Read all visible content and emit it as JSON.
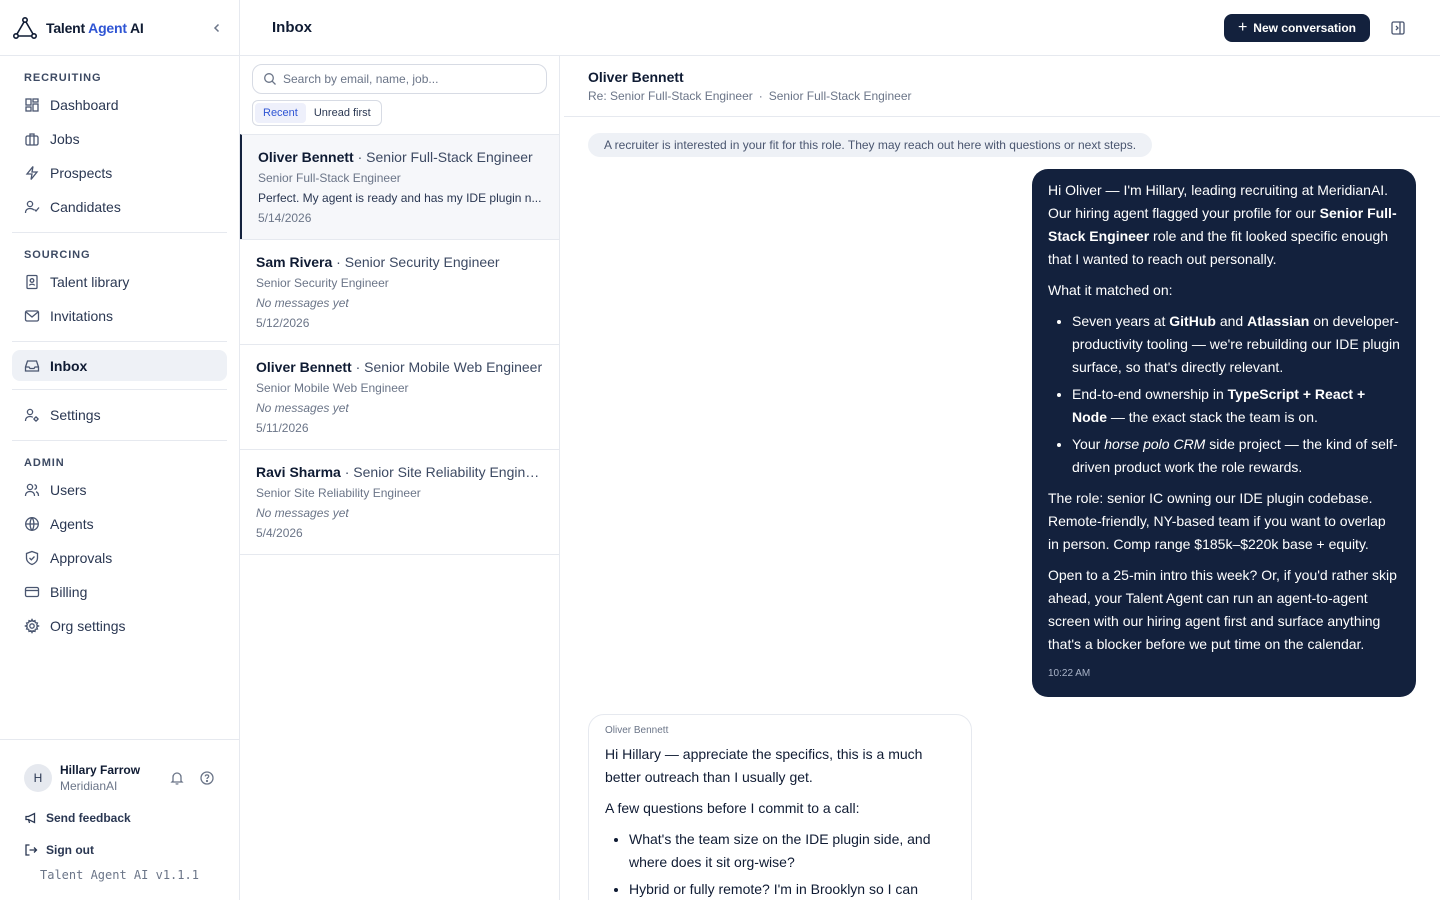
{
  "brand": {
    "name_prefix": "Talent ",
    "name_accent": "Agent",
    "name_suffix": " AI"
  },
  "sidebar": {
    "sections": {
      "recruiting": "RECRUITING",
      "sourcing": "SOURCING",
      "admin": "ADMIN"
    },
    "items": {
      "dashboard": "Dashboard",
      "jobs": "Jobs",
      "prospects": "Prospects",
      "candidates": "Candidates",
      "talent_library": "Talent library",
      "invitations": "Invitations",
      "inbox": "Inbox",
      "settings": "Settings",
      "users": "Users",
      "agents": "Agents",
      "approvals": "Approvals",
      "billing": "Billing",
      "org_settings": "Org settings"
    },
    "user": {
      "initial": "H",
      "name": "Hillary Farrow",
      "org": "MeridianAI"
    },
    "footer": {
      "send_feedback": "Send feedback",
      "sign_out": "Sign out",
      "version": "Talent Agent AI v1.1.1"
    }
  },
  "topbar": {
    "title": "Inbox",
    "new_conversation": "New conversation"
  },
  "convlist": {
    "search_placeholder": "Search by email, name, job...",
    "tabs": [
      "Recent",
      "Unread first"
    ],
    "items": [
      {
        "name": "Oliver Bennett",
        "sep": " · ",
        "title": "Senior Full-Stack Engineer",
        "role": "Senior Full-Stack Engineer",
        "preview": "Perfect. My agent is ready and has my IDE plugin n...",
        "date": "5/14/2026"
      },
      {
        "name": "Sam Rivera",
        "sep": " · ",
        "title": "Senior Security Engineer",
        "role": "Senior Security Engineer",
        "preview": "No messages yet",
        "date": "5/12/2026"
      },
      {
        "name": "Oliver Bennett",
        "sep": " · ",
        "title": "Senior Mobile Web Engineer",
        "role": "Senior Mobile Web Engineer",
        "preview": "No messages yet",
        "date": "5/11/2026"
      },
      {
        "name": "Ravi Sharma",
        "sep": " · ",
        "title": "Senior Site Reliability Engineer",
        "role": "Senior Site Reliability Engineer",
        "preview": "No messages yet",
        "date": "5/4/2026"
      }
    ]
  },
  "thread": {
    "name": "Oliver Bennett",
    "subject": "Re: Senior Full-Stack Engineer",
    "dot": "·",
    "job": "Senior Full-Stack Engineer",
    "system_note": "A recruiter is interested in your fit for this role. They may reach out here with questions or next steps.",
    "outgoing": {
      "p1_a": "Hi Oliver — I'm Hillary, leading recruiting at MeridianAI. Our hiring agent flagged your profile for our ",
      "p1_b": "Senior Full-Stack Engineer",
      "p1_c": " role and the fit looked specific enough that I wanted to reach out personally.",
      "p2": "What it matched on:",
      "li1_a": "Seven years at ",
      "li1_b": "GitHub",
      "li1_c": " and ",
      "li1_d": "Atlassian",
      "li1_e": " on developer-productivity tooling — we're rebuilding our IDE plugin surface, so that's directly relevant.",
      "li2_a": "End-to-end ownership in ",
      "li2_b": "TypeScript + React + Node",
      "li2_c": " — the exact stack the team is on.",
      "li3_a": "Your ",
      "li3_b": "horse polo CRM",
      "li3_c": " side project — the kind of self-driven product work the role rewards.",
      "p3": "The role: senior IC owning our IDE plugin codebase. Remote-friendly, NY-based team if you want to overlap in person. Comp range $185k–$220k base + equity.",
      "p4": "Open to a 25-min intro this week? Or, if you'd rather skip ahead, your Talent Agent can run an agent-to-agent screen with our hiring agent first and surface anything that's a blocker before we put time on the calendar.",
      "time": "10:22 AM"
    },
    "incoming": {
      "sender": "Oliver Bennett",
      "p1": "Hi Hillary — appreciate the specifics, this is a much better outreach than I usually get.",
      "p2": "A few questions before I commit to a call:",
      "li1": "What's the team size on the IDE plugin side, and where does it sit org-wise?",
      "li2": "Hybrid or fully remote? I'm in Brooklyn so I can"
    }
  },
  "colors": {
    "primary": "#13213d",
    "accent": "#2f55d4",
    "border": "#e6e9ef",
    "muted": "#6b7588"
  }
}
